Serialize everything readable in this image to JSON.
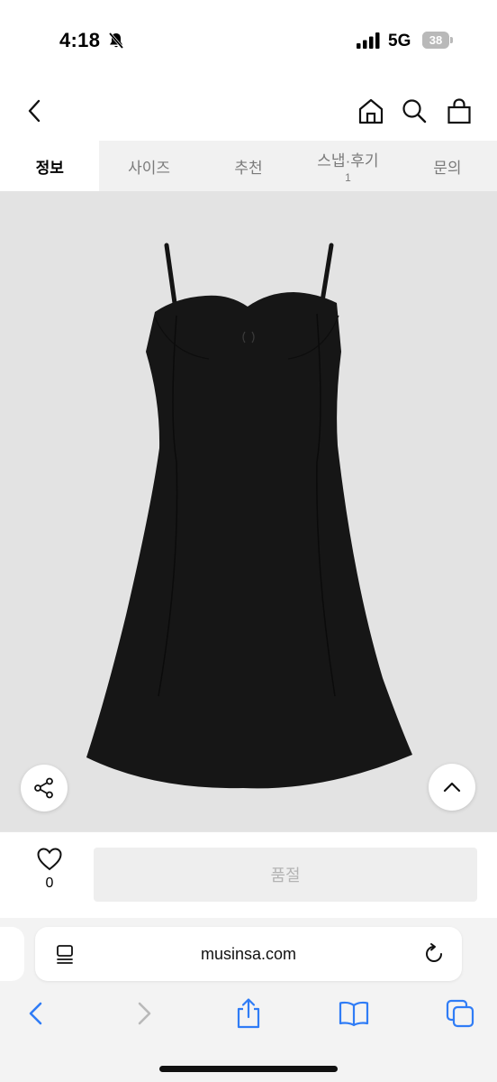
{
  "status_bar": {
    "time": "4:18",
    "network": "5G",
    "battery_percent": "38",
    "battery_level": 0.38,
    "icons": [
      "bell-slash-icon",
      "signal-icon",
      "battery-icon"
    ]
  },
  "header": {
    "icons": [
      "back-chevron-icon",
      "home-icon",
      "search-icon",
      "shopping-bag-icon"
    ]
  },
  "tabs": [
    {
      "label": "정보",
      "active": true
    },
    {
      "label": "사이즈",
      "active": false
    },
    {
      "label": "추천",
      "active": false
    },
    {
      "label": "스냅·후기",
      "count": "1",
      "active": false
    },
    {
      "label": "문의",
      "active": false
    }
  ],
  "product": {
    "image": "black-sleeveless-mini-dress",
    "icons": [
      "share-icon",
      "chevron-up-icon"
    ],
    "background": "#e3e3e3"
  },
  "action_bar": {
    "like_count": "0",
    "soldout_label": "품절",
    "icons": [
      "heart-outline-icon"
    ]
  },
  "browser": {
    "url": "musinsa.com",
    "icons": [
      "page-menu-icon",
      "reload-icon",
      "back-icon",
      "forward-icon",
      "share-icon",
      "bookmarks-icon",
      "tabs-icon"
    ],
    "accent": "#2f7cf6"
  }
}
